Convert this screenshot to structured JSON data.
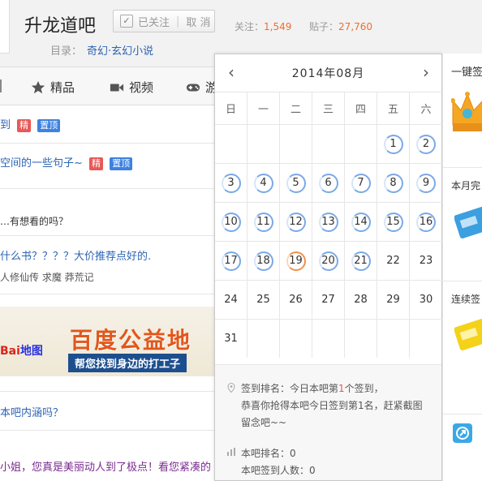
{
  "header": {
    "forum_name": "升龙道吧",
    "follow_status": "已关注",
    "unfollow_label": "取 消",
    "followers_label": "关注：",
    "followers_count": "1,549",
    "posts_label": "贴子：",
    "posts_count": "27,760",
    "catalog_label": "目录：",
    "catalog_link": "奇幻·玄幻小说"
  },
  "nav": {
    "items": [
      {
        "label": "精品",
        "icon": "star-icon"
      },
      {
        "label": "视频",
        "icon": "video-camera-icon"
      },
      {
        "label": "游",
        "icon": "gamepad-icon"
      }
    ]
  },
  "threads": [
    {
      "title": "到",
      "badges": [
        "精",
        "置顶"
      ]
    },
    {
      "title": "空间的一些句子~",
      "badges": [
        "精",
        "置顶"
      ]
    },
    {
      "title": "…有想看的吗？",
      "sub": ""
    },
    {
      "title": "什么书？？？？大价推荐点好的.",
      "sub": "人修仙传 求魔 莽荒记"
    },
    {
      "title": "本吧内涵吗？"
    },
    {
      "title": "小姐，您真是美丽动人到了极点！看您紧凑的"
    }
  ],
  "banner": {
    "logo_red": "Bai",
    "logo_rest": "地图",
    "title": "百度公益地",
    "slogan": "帮您找到身边的打工子"
  },
  "calendar": {
    "title": "2014年08月",
    "prev_icon": "chevron-left-icon",
    "next_icon": "chevron-right-icon",
    "weekdays": [
      "日",
      "一",
      "二",
      "三",
      "四",
      "五",
      "六"
    ],
    "weeks": [
      [
        "",
        "",
        "",
        "",
        "",
        "1",
        "2"
      ],
      [
        "3",
        "4",
        "5",
        "6",
        "7",
        "8",
        "9"
      ],
      [
        "10",
        "11",
        "12",
        "13",
        "14",
        "15",
        "16"
      ],
      [
        "17",
        "18",
        "19",
        "20",
        "21",
        "22",
        "23"
      ],
      [
        "24",
        "25",
        "26",
        "27",
        "28",
        "29",
        "30"
      ],
      [
        "31",
        "",
        "",
        "",
        "",
        "",
        ""
      ]
    ],
    "signed_days": [
      "1",
      "2",
      "3",
      "4",
      "5",
      "6",
      "7",
      "8",
      "9",
      "10",
      "11",
      "12",
      "13",
      "14",
      "15",
      "16",
      "17",
      "18",
      "20",
      "21"
    ],
    "today": "19",
    "info": {
      "rank_prefix": "签到排名：今日本吧第",
      "rank_num": "1",
      "rank_suffix": "个签到，",
      "congrats_1": "恭喜你抢得本吧今日签到第1名，赶紧截图",
      "congrats_2": "留念吧~~",
      "forum_rank": "本吧排名：0",
      "forum_signers": "本吧签到人数：0"
    }
  },
  "right_panel": {
    "title_1": "一键签",
    "title_2": "本月完",
    "title_3": "连续签"
  },
  "colors": {
    "link": "#2d64b3",
    "accent": "#f06d2e",
    "signed_ring": "#7aa9e6",
    "today_ring": "#f19149"
  }
}
